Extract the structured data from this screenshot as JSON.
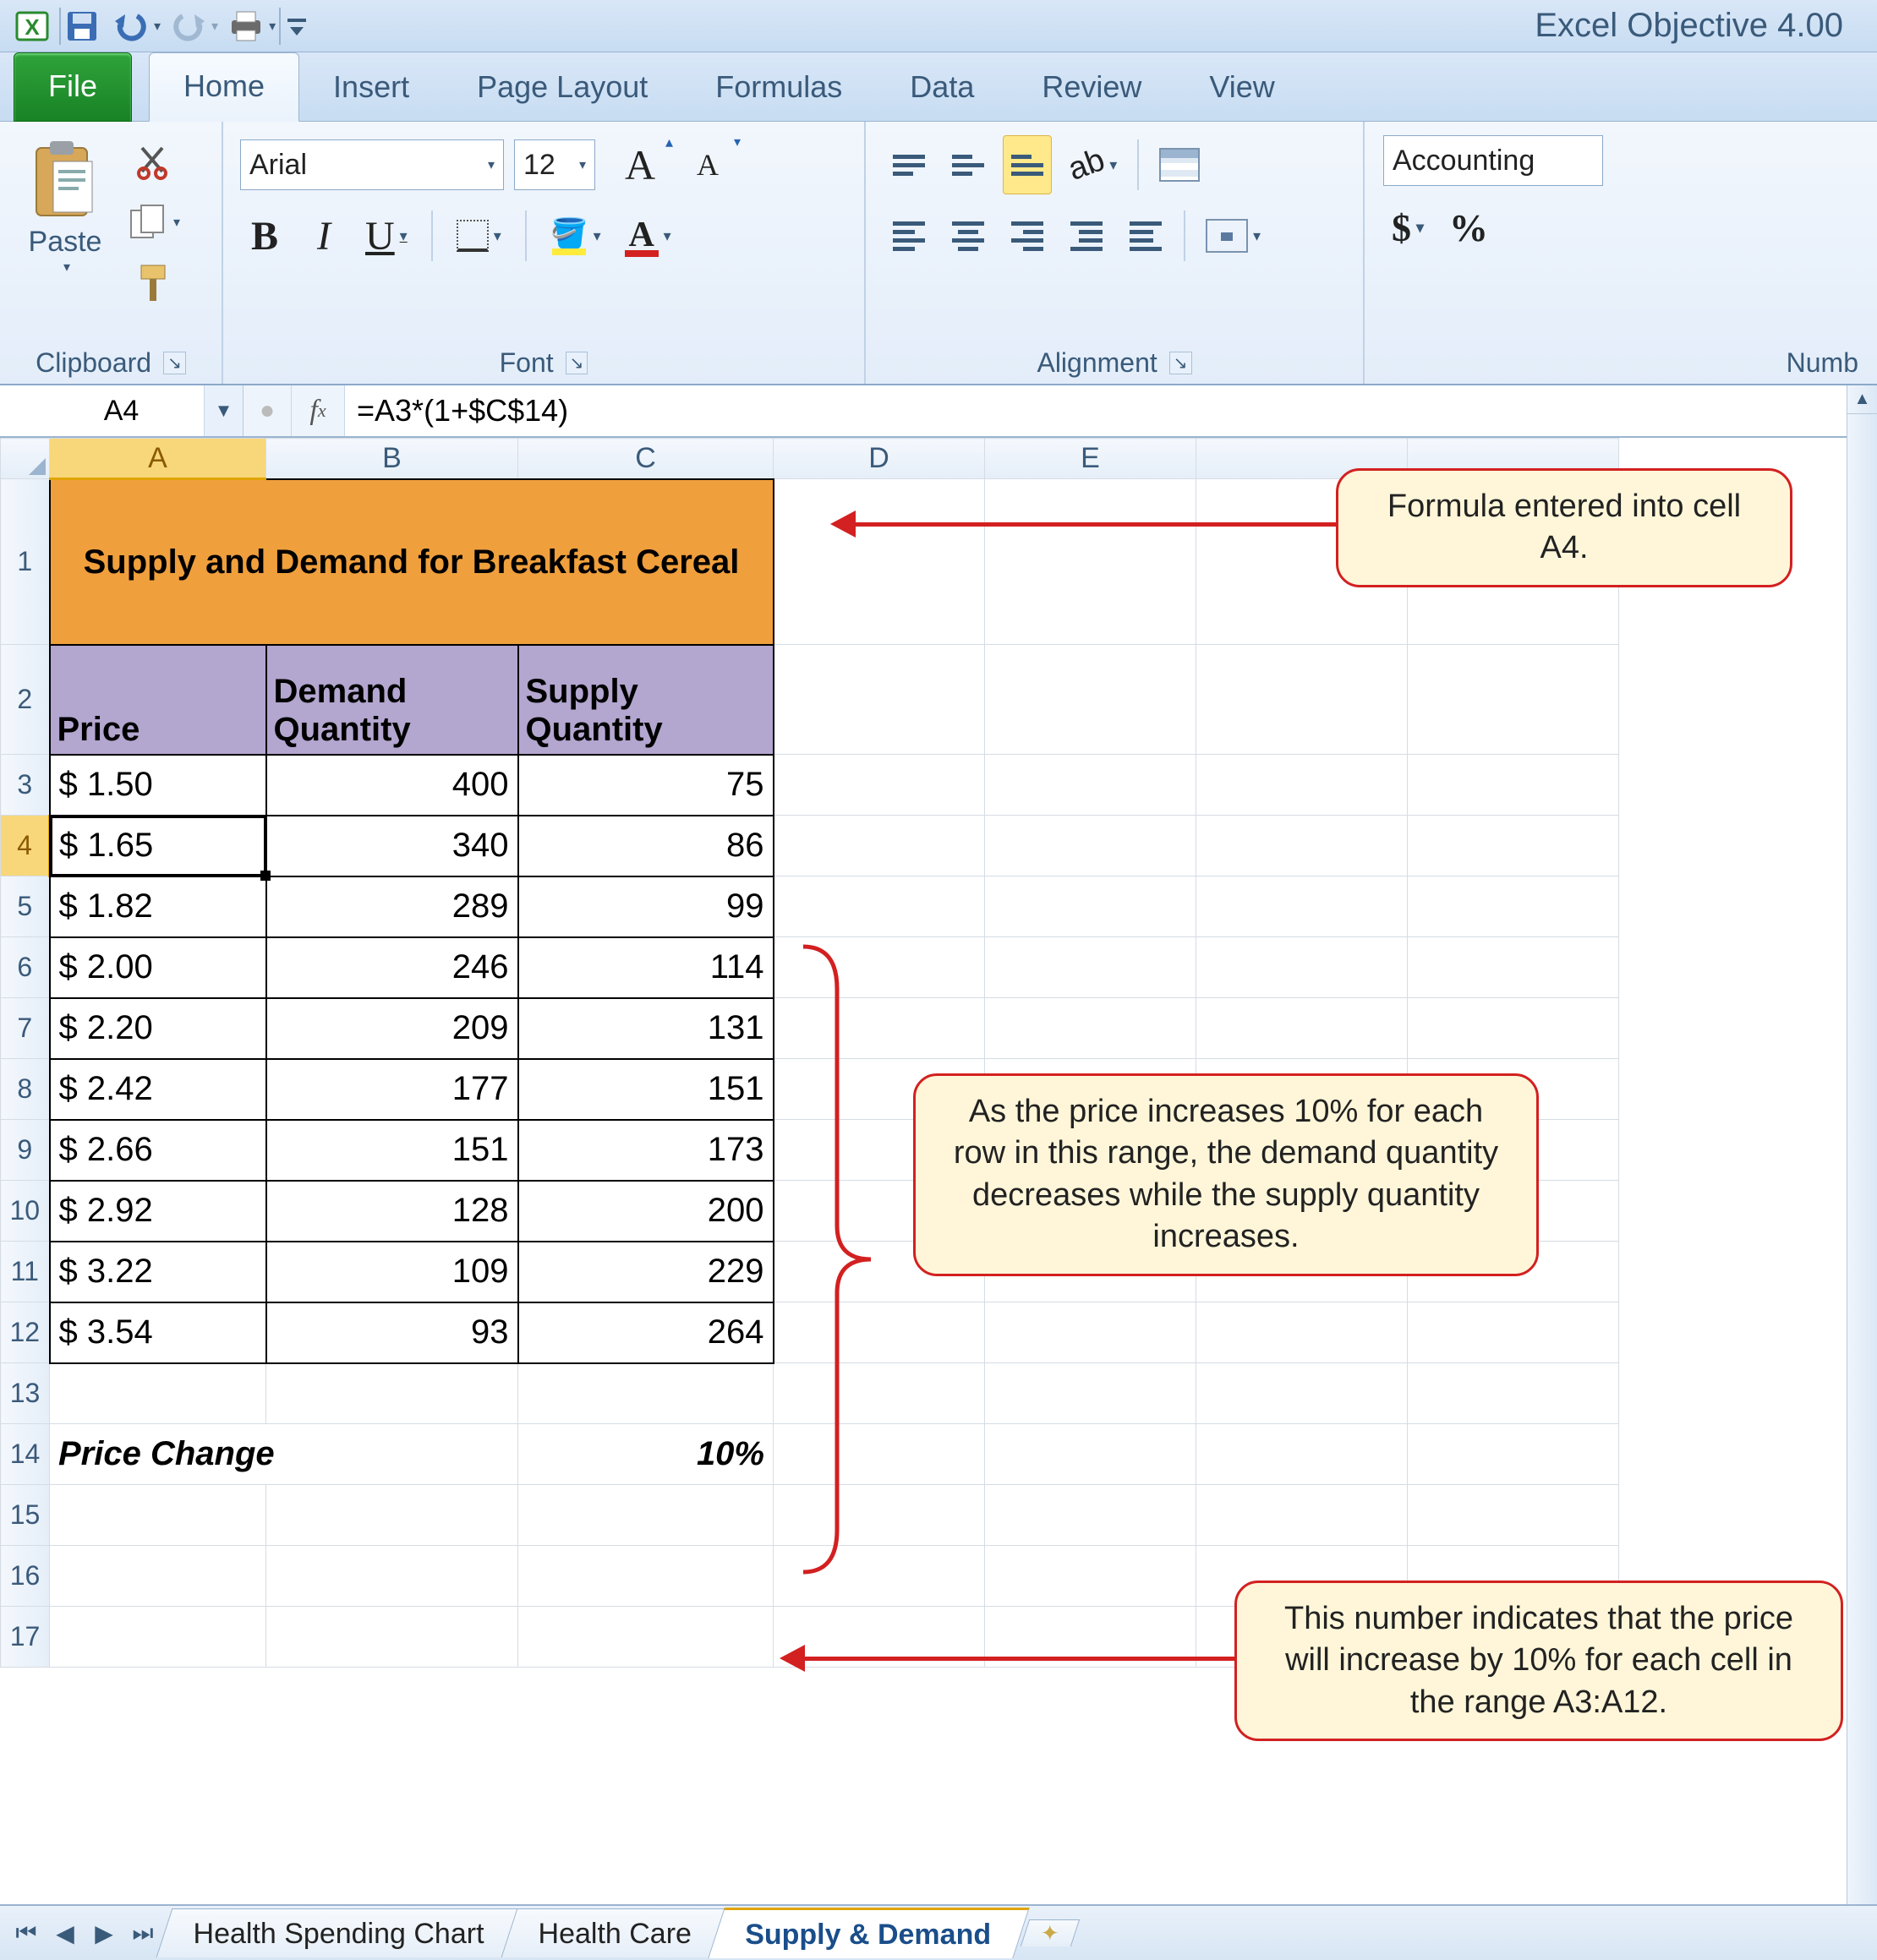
{
  "window": {
    "title": "Excel Objective 4.00"
  },
  "ribbon_tabs": {
    "file": "File",
    "home": "Home",
    "insert": "Insert",
    "page_layout": "Page Layout",
    "formulas": "Formulas",
    "data": "Data",
    "review": "Review",
    "view": "View"
  },
  "ribbon": {
    "clipboard": {
      "label": "Clipboard",
      "paste": "Paste"
    },
    "font": {
      "label": "Font",
      "name": "Arial",
      "size": "12"
    },
    "alignment": {
      "label": "Alignment"
    },
    "number": {
      "label": "Numb",
      "format": "Accounting"
    }
  },
  "formula_bar": {
    "name_box": "A4",
    "formula": "=A3*(1+$C$14)"
  },
  "columns": [
    "A",
    "B",
    "C",
    "D",
    "E"
  ],
  "sheet": "Supply & Demand",
  "sheet_tabs": [
    "Health Spending Chart",
    "Health Care",
    "Supply & Demand"
  ],
  "cells": {
    "title": "Supply and Demand for Breakfast Cereal",
    "h_price": "Price",
    "h_demand": "Demand Quantity",
    "h_supply": "Supply Quantity",
    "rows": [
      {
        "price": "$   1.50",
        "demand": "400",
        "supply": "75"
      },
      {
        "price": "$   1.65",
        "demand": "340",
        "supply": "86"
      },
      {
        "price": "$   1.82",
        "demand": "289",
        "supply": "99"
      },
      {
        "price": "$   2.00",
        "demand": "246",
        "supply": "114"
      },
      {
        "price": "$   2.20",
        "demand": "209",
        "supply": "131"
      },
      {
        "price": "$   2.42",
        "demand": "177",
        "supply": "151"
      },
      {
        "price": "$   2.66",
        "demand": "151",
        "supply": "173"
      },
      {
        "price": "$   2.92",
        "demand": "128",
        "supply": "200"
      },
      {
        "price": "$   3.22",
        "demand": "109",
        "supply": "229"
      },
      {
        "price": "$   3.54",
        "demand": "93",
        "supply": "264"
      }
    ],
    "pchg_label": "Price Change",
    "pchg_val": "10%"
  },
  "callouts": {
    "c1": "Formula entered into cell A4.",
    "c2": "As the price increases 10% for each row in this range, the demand quantity decreases while the supply quantity increases.",
    "c3": "This number indicates that the price will increase by 10% for each cell in the range A3:A12."
  },
  "chart_data": {
    "type": "table",
    "title": "Supply and Demand for Breakfast Cereal",
    "columns": [
      "Price",
      "Demand Quantity",
      "Supply Quantity"
    ],
    "rows": [
      [
        1.5,
        400,
        75
      ],
      [
        1.65,
        340,
        86
      ],
      [
        1.82,
        289,
        99
      ],
      [
        2.0,
        246,
        114
      ],
      [
        2.2,
        209,
        131
      ],
      [
        2.42,
        177,
        151
      ],
      [
        2.66,
        151,
        173
      ],
      [
        2.92,
        128,
        200
      ],
      [
        3.22,
        109,
        229
      ],
      [
        3.54,
        93,
        264
      ]
    ],
    "price_change": 0.1
  }
}
